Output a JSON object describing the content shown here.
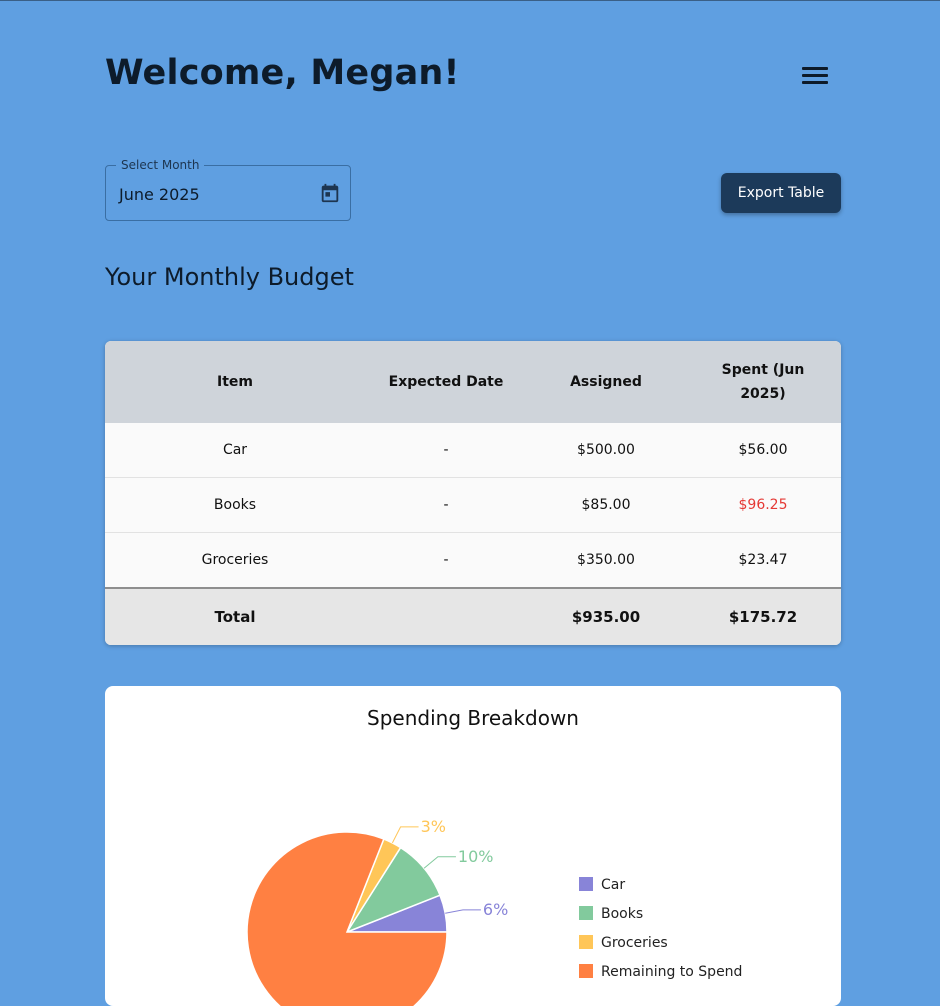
{
  "header": {
    "title": "Welcome, Megan!"
  },
  "month_picker": {
    "label": "Select Month",
    "value": "June 2025"
  },
  "export_button": {
    "label": "Export Table"
  },
  "section": {
    "title": "Your Monthly Budget"
  },
  "table": {
    "columns": [
      "Item",
      "Expected Date",
      "Assigned",
      "Spent (Jun 2025)"
    ],
    "rows": [
      {
        "item": "Car",
        "date": "-",
        "assigned": "$500.00",
        "spent": "$56.00"
      },
      {
        "item": "Books",
        "date": "-",
        "assigned": "$85.00",
        "spent": "$96.25"
      },
      {
        "item": "Groceries",
        "date": "-",
        "assigned": "$350.00",
        "spent": "$23.47"
      }
    ],
    "total": {
      "label": "Total",
      "assigned": "$935.00",
      "spent": "$175.72"
    },
    "over_budget_color": "#e53935"
  },
  "chart_data": {
    "type": "pie",
    "title": "Spending Breakdown",
    "slices": [
      {
        "label": "Car",
        "percent_label": "6%",
        "value": 6,
        "color": "#8884d8"
      },
      {
        "label": "Books",
        "percent_label": "10%",
        "value": 10,
        "color": "#82ca9d"
      },
      {
        "label": "Groceries",
        "percent_label": "3%",
        "value": 3,
        "color": "#ffc658"
      },
      {
        "label": "Remaining to Spend",
        "percent_label": "",
        "value": 81,
        "color": "#ff8042"
      }
    ],
    "legend_position": "right"
  },
  "colors": {
    "background": "#5f9fe1",
    "button": "#1c3a5a"
  }
}
